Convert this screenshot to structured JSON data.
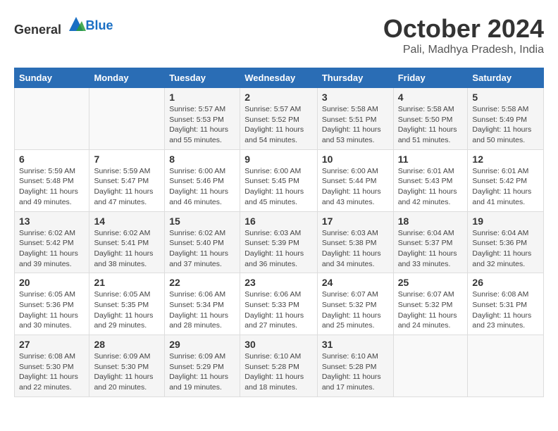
{
  "header": {
    "logo_general": "General",
    "logo_blue": "Blue",
    "month": "October 2024",
    "location": "Pali, Madhya Pradesh, India"
  },
  "columns": [
    "Sunday",
    "Monday",
    "Tuesday",
    "Wednesday",
    "Thursday",
    "Friday",
    "Saturday"
  ],
  "weeks": [
    [
      {
        "day": "",
        "detail": ""
      },
      {
        "day": "",
        "detail": ""
      },
      {
        "day": "1",
        "detail": "Sunrise: 5:57 AM\nSunset: 5:53 PM\nDaylight: 11 hours and 55 minutes."
      },
      {
        "day": "2",
        "detail": "Sunrise: 5:57 AM\nSunset: 5:52 PM\nDaylight: 11 hours and 54 minutes."
      },
      {
        "day": "3",
        "detail": "Sunrise: 5:58 AM\nSunset: 5:51 PM\nDaylight: 11 hours and 53 minutes."
      },
      {
        "day": "4",
        "detail": "Sunrise: 5:58 AM\nSunset: 5:50 PM\nDaylight: 11 hours and 51 minutes."
      },
      {
        "day": "5",
        "detail": "Sunrise: 5:58 AM\nSunset: 5:49 PM\nDaylight: 11 hours and 50 minutes."
      }
    ],
    [
      {
        "day": "6",
        "detail": "Sunrise: 5:59 AM\nSunset: 5:48 PM\nDaylight: 11 hours and 49 minutes."
      },
      {
        "day": "7",
        "detail": "Sunrise: 5:59 AM\nSunset: 5:47 PM\nDaylight: 11 hours and 47 minutes."
      },
      {
        "day": "8",
        "detail": "Sunrise: 6:00 AM\nSunset: 5:46 PM\nDaylight: 11 hours and 46 minutes."
      },
      {
        "day": "9",
        "detail": "Sunrise: 6:00 AM\nSunset: 5:45 PM\nDaylight: 11 hours and 45 minutes."
      },
      {
        "day": "10",
        "detail": "Sunrise: 6:00 AM\nSunset: 5:44 PM\nDaylight: 11 hours and 43 minutes."
      },
      {
        "day": "11",
        "detail": "Sunrise: 6:01 AM\nSunset: 5:43 PM\nDaylight: 11 hours and 42 minutes."
      },
      {
        "day": "12",
        "detail": "Sunrise: 6:01 AM\nSunset: 5:42 PM\nDaylight: 11 hours and 41 minutes."
      }
    ],
    [
      {
        "day": "13",
        "detail": "Sunrise: 6:02 AM\nSunset: 5:42 PM\nDaylight: 11 hours and 39 minutes."
      },
      {
        "day": "14",
        "detail": "Sunrise: 6:02 AM\nSunset: 5:41 PM\nDaylight: 11 hours and 38 minutes."
      },
      {
        "day": "15",
        "detail": "Sunrise: 6:02 AM\nSunset: 5:40 PM\nDaylight: 11 hours and 37 minutes."
      },
      {
        "day": "16",
        "detail": "Sunrise: 6:03 AM\nSunset: 5:39 PM\nDaylight: 11 hours and 36 minutes."
      },
      {
        "day": "17",
        "detail": "Sunrise: 6:03 AM\nSunset: 5:38 PM\nDaylight: 11 hours and 34 minutes."
      },
      {
        "day": "18",
        "detail": "Sunrise: 6:04 AM\nSunset: 5:37 PM\nDaylight: 11 hours and 33 minutes."
      },
      {
        "day": "19",
        "detail": "Sunrise: 6:04 AM\nSunset: 5:36 PM\nDaylight: 11 hours and 32 minutes."
      }
    ],
    [
      {
        "day": "20",
        "detail": "Sunrise: 6:05 AM\nSunset: 5:36 PM\nDaylight: 11 hours and 30 minutes."
      },
      {
        "day": "21",
        "detail": "Sunrise: 6:05 AM\nSunset: 5:35 PM\nDaylight: 11 hours and 29 minutes."
      },
      {
        "day": "22",
        "detail": "Sunrise: 6:06 AM\nSunset: 5:34 PM\nDaylight: 11 hours and 28 minutes."
      },
      {
        "day": "23",
        "detail": "Sunrise: 6:06 AM\nSunset: 5:33 PM\nDaylight: 11 hours and 27 minutes."
      },
      {
        "day": "24",
        "detail": "Sunrise: 6:07 AM\nSunset: 5:32 PM\nDaylight: 11 hours and 25 minutes."
      },
      {
        "day": "25",
        "detail": "Sunrise: 6:07 AM\nSunset: 5:32 PM\nDaylight: 11 hours and 24 minutes."
      },
      {
        "day": "26",
        "detail": "Sunrise: 6:08 AM\nSunset: 5:31 PM\nDaylight: 11 hours and 23 minutes."
      }
    ],
    [
      {
        "day": "27",
        "detail": "Sunrise: 6:08 AM\nSunset: 5:30 PM\nDaylight: 11 hours and 22 minutes."
      },
      {
        "day": "28",
        "detail": "Sunrise: 6:09 AM\nSunset: 5:30 PM\nDaylight: 11 hours and 20 minutes."
      },
      {
        "day": "29",
        "detail": "Sunrise: 6:09 AM\nSunset: 5:29 PM\nDaylight: 11 hours and 19 minutes."
      },
      {
        "day": "30",
        "detail": "Sunrise: 6:10 AM\nSunset: 5:28 PM\nDaylight: 11 hours and 18 minutes."
      },
      {
        "day": "31",
        "detail": "Sunrise: 6:10 AM\nSunset: 5:28 PM\nDaylight: 11 hours and 17 minutes."
      },
      {
        "day": "",
        "detail": ""
      },
      {
        "day": "",
        "detail": ""
      }
    ]
  ]
}
